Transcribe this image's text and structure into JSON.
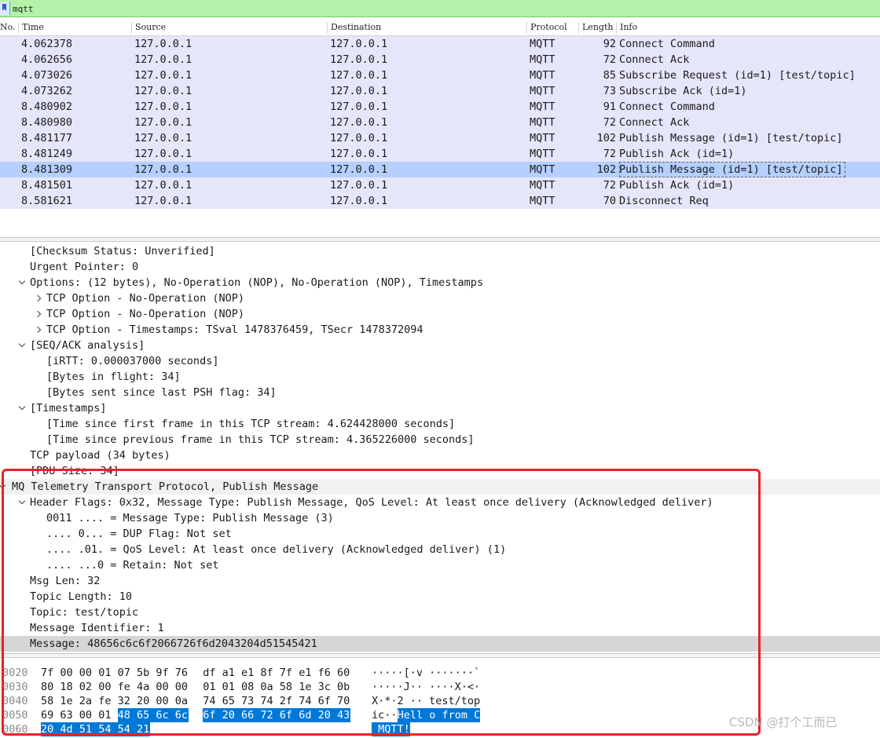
{
  "filter": {
    "value": "mqtt"
  },
  "columns": [
    "No.",
    "Time",
    "Source",
    "Destination",
    "Protocol",
    "Length",
    "Info"
  ],
  "packets": [
    {
      "time": "4.062378",
      "source": "127.0.0.1",
      "destination": "127.0.0.1",
      "protocol": "MQTT",
      "length": "92",
      "info": "Connect Command",
      "selected": false
    },
    {
      "time": "4.062656",
      "source": "127.0.0.1",
      "destination": "127.0.0.1",
      "protocol": "MQTT",
      "length": "72",
      "info": "Connect Ack",
      "selected": false
    },
    {
      "time": "4.073026",
      "source": "127.0.0.1",
      "destination": "127.0.0.1",
      "protocol": "MQTT",
      "length": "85",
      "info": "Subscribe Request (id=1) [test/topic]",
      "selected": false
    },
    {
      "time": "4.073262",
      "source": "127.0.0.1",
      "destination": "127.0.0.1",
      "protocol": "MQTT",
      "length": "73",
      "info": "Subscribe Ack (id=1)",
      "selected": false
    },
    {
      "time": "8.480902",
      "source": "127.0.0.1",
      "destination": "127.0.0.1",
      "protocol": "MQTT",
      "length": "91",
      "info": "Connect Command",
      "selected": false
    },
    {
      "time": "8.480980",
      "source": "127.0.0.1",
      "destination": "127.0.0.1",
      "protocol": "MQTT",
      "length": "72",
      "info": "Connect Ack",
      "selected": false
    },
    {
      "time": "8.481177",
      "source": "127.0.0.1",
      "destination": "127.0.0.1",
      "protocol": "MQTT",
      "length": "102",
      "info": "Publish Message (id=1) [test/topic]",
      "selected": false
    },
    {
      "time": "8.481249",
      "source": "127.0.0.1",
      "destination": "127.0.0.1",
      "protocol": "MQTT",
      "length": "72",
      "info": "Publish Ack (id=1)",
      "selected": false
    },
    {
      "time": "8.481309",
      "source": "127.0.0.1",
      "destination": "127.0.0.1",
      "protocol": "MQTT",
      "length": "102",
      "info": "Publish Message (id=1) [test/topic]",
      "selected": true
    },
    {
      "time": "8.481501",
      "source": "127.0.0.1",
      "destination": "127.0.0.1",
      "protocol": "MQTT",
      "length": "72",
      "info": "Publish Ack (id=1)",
      "selected": false
    },
    {
      "time": "8.581621",
      "source": "127.0.0.1",
      "destination": "127.0.0.1",
      "protocol": "MQTT",
      "length": "70",
      "info": "Disconnect Req",
      "selected": false
    }
  ],
  "details": [
    {
      "indent": 2,
      "exp": "none",
      "text": "[Checksum Status: Unverified]",
      "style": ""
    },
    {
      "indent": 2,
      "exp": "none",
      "text": "Urgent Pointer: 0",
      "style": ""
    },
    {
      "indent": 2,
      "exp": "down",
      "text": "Options: (12 bytes), No-Operation (NOP), No-Operation (NOP), Timestamps",
      "style": ""
    },
    {
      "indent": 3,
      "exp": "right",
      "text": "TCP Option - No-Operation (NOP)",
      "style": ""
    },
    {
      "indent": 3,
      "exp": "right",
      "text": "TCP Option - No-Operation (NOP)",
      "style": ""
    },
    {
      "indent": 3,
      "exp": "right",
      "text": "TCP Option - Timestamps: TSval 1478376459, TSecr 1478372094",
      "style": ""
    },
    {
      "indent": 2,
      "exp": "down",
      "text": "[SEQ/ACK analysis]",
      "style": ""
    },
    {
      "indent": 3,
      "exp": "none",
      "text": "[iRTT: 0.000037000 seconds]",
      "style": ""
    },
    {
      "indent": 3,
      "exp": "none",
      "text": "[Bytes in flight: 34]",
      "style": ""
    },
    {
      "indent": 3,
      "exp": "none",
      "text": "[Bytes sent since last PSH flag: 34]",
      "style": ""
    },
    {
      "indent": 2,
      "exp": "down",
      "text": "[Timestamps]",
      "style": ""
    },
    {
      "indent": 3,
      "exp": "none",
      "text": "[Time since first frame in this TCP stream: 4.624428000 seconds]",
      "style": ""
    },
    {
      "indent": 3,
      "exp": "none",
      "text": "[Time since previous frame in this TCP stream: 4.365226000 seconds]",
      "style": ""
    },
    {
      "indent": 2,
      "exp": "none",
      "text": "TCP payload (34 bytes)",
      "style": ""
    },
    {
      "indent": 2,
      "exp": "none",
      "text": "[PDU Size: 34]",
      "style": ""
    },
    {
      "indent": 1,
      "exp": "down",
      "text": "MQ Telemetry Transport Protocol, Publish Message",
      "style": "section"
    },
    {
      "indent": 2,
      "exp": "down",
      "text": "Header Flags: 0x32, Message Type: Publish Message, QoS Level: At least once delivery (Acknowledged deliver)",
      "style": ""
    },
    {
      "indent": 3,
      "exp": "none",
      "text": "0011 .... = Message Type: Publish Message (3)",
      "style": ""
    },
    {
      "indent": 3,
      "exp": "none",
      "text": ".... 0... = DUP Flag: Not set",
      "style": ""
    },
    {
      "indent": 3,
      "exp": "none",
      "text": ".... .01. = QoS Level: At least once delivery (Acknowledged deliver) (1)",
      "style": ""
    },
    {
      "indent": 3,
      "exp": "none",
      "text": ".... ...0 = Retain: Not set",
      "style": ""
    },
    {
      "indent": 2,
      "exp": "none",
      "text": "Msg Len: 32",
      "style": ""
    },
    {
      "indent": 2,
      "exp": "none",
      "text": "Topic Length: 10",
      "style": ""
    },
    {
      "indent": 2,
      "exp": "none",
      "text": "Topic: test/topic",
      "style": ""
    },
    {
      "indent": 2,
      "exp": "none",
      "text": "Message Identifier: 1",
      "style": ""
    },
    {
      "indent": 2,
      "exp": "none",
      "text": "Message: 48656c6c6f2066726f6d2043204d51545421",
      "style": "highlight"
    }
  ],
  "hex_rows": [
    {
      "offset": "0020",
      "bytes": [
        "7f",
        "00",
        "00",
        "01",
        "07",
        "5b",
        "9f",
        "76",
        "df",
        "a1",
        "e1",
        "8f",
        "7f",
        "e1",
        "f6",
        "60"
      ],
      "hl_start": 16,
      "ascii": "·····[·v ·······`",
      "ascii_hl_start": 17
    },
    {
      "offset": "0030",
      "bytes": [
        "80",
        "18",
        "02",
        "00",
        "fe",
        "4a",
        "00",
        "00",
        "01",
        "01",
        "08",
        "0a",
        "58",
        "1e",
        "3c",
        "0b"
      ],
      "hl_start": 16,
      "ascii": "·····J·· ····X·<·",
      "ascii_hl_start": 17
    },
    {
      "offset": "0040",
      "bytes": [
        "58",
        "1e",
        "2a",
        "fe",
        "32",
        "20",
        "00",
        "0a",
        "74",
        "65",
        "73",
        "74",
        "2f",
        "74",
        "6f",
        "70"
      ],
      "hl_start": 16,
      "ascii": "X·*·2 ·· test/top",
      "ascii_hl_start": 17
    },
    {
      "offset": "0050",
      "bytes": [
        "69",
        "63",
        "00",
        "01",
        "48",
        "65",
        "6c",
        "6c",
        "6f",
        "20",
        "66",
        "72",
        "6f",
        "6d",
        "20",
        "43"
      ],
      "hl_start": 4,
      "ascii": "ic··Hell o from C",
      "ascii_hl_start": 4
    },
    {
      "offset": "0060",
      "bytes": [
        "20",
        "4d",
        "51",
        "54",
        "54",
        "21"
      ],
      "hl_start": 0,
      "ascii": " MQTT!",
      "ascii_hl_start": 0
    }
  ],
  "watermark": "CSDN @打个工而已",
  "colors": {
    "filter_bg": "#b3f2a8",
    "row_bg": "#e6e6fa",
    "selected_bg": "#b5d0ff",
    "hex_highlight": "#0078d7",
    "annotation": "#e8222a"
  }
}
